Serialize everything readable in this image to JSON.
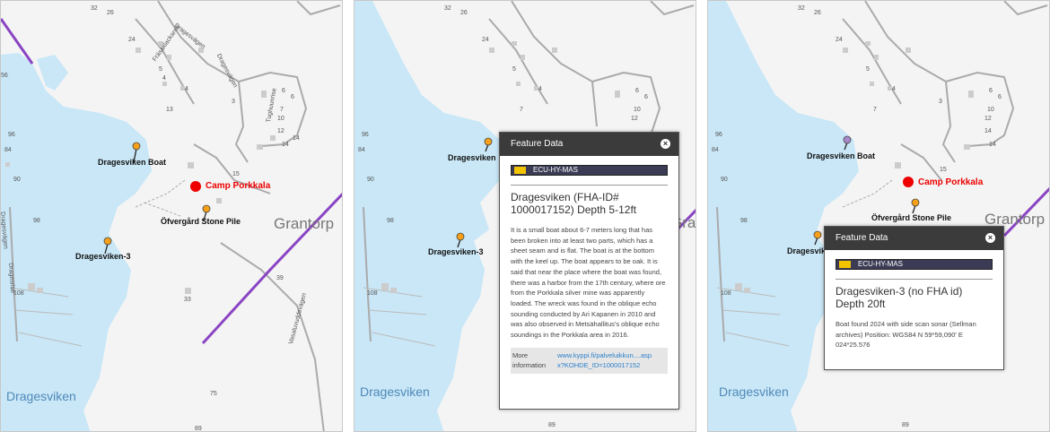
{
  "colors": {
    "water": "#c9e7f7",
    "land": "#f4f4f4",
    "road": "#aaaaaa",
    "border": "#8a44c4",
    "pin": "#f7a11a",
    "camp": "#ee0000"
  },
  "panels": [
    {
      "numbers": [
        "32",
        "26",
        "24",
        "4",
        "5",
        "13",
        "4",
        "6",
        "6",
        "3",
        "7",
        "10",
        "12",
        "14",
        "14",
        "15",
        "96",
        "84",
        "90",
        "98",
        "108",
        "39",
        "33",
        "75",
        "89",
        "56"
      ],
      "roads": [
        "Dragesvägen",
        "Fräsaklackarne",
        "Dragesvägen",
        "Tughuunrise",
        "Dragesvägen",
        "Dragesrise",
        "Vasaluvuddsvägen"
      ],
      "pins": [
        {
          "name": "Dragesviken  Boat"
        },
        {
          "name": "Öfvergård Stone Pile"
        },
        {
          "name": "Dragesviken-3"
        }
      ],
      "camp": "Camp Porkkala",
      "place": "Grantorp",
      "water": "Dragesviken"
    },
    {
      "pins": [
        {
          "name": "Dragesviken"
        },
        {
          "name": "Dragesviken-3"
        }
      ],
      "place": "Grantorp",
      "water": "Dragesviken",
      "numbers": [
        "32",
        "26",
        "24",
        "4",
        "5",
        "6",
        "6",
        "7",
        "10",
        "12",
        "96",
        "84",
        "90",
        "98",
        "108",
        "89"
      ],
      "popup": {
        "header": "Feature Data",
        "close": "×",
        "tag": "ECU-HY-MAS",
        "title": "Dragesviken (FHA-ID# 1000017152) Depth 5-12ft",
        "body": "It is a small boat about 6-7 meters long that has been broken into at least two parts, which has a sheet seam and is flat. The boat is at the bottom with the keel up. The boat appears to be oak. It is said that near the place where the boat was found, there was a harbor from the 17th century, where ore from the Porkkala silver mine was apparently loaded. The wreck was found in the oblique echo sounding conducted by Ari Kapanen in 2010 and was also observed in Metsähallitus's oblique echo soundings in the Porkkala area in 2016.",
        "more_label": "More information",
        "more_link": "www.kyppi.fi/palveluikkun....aspx?KOHDE_ID=1000017152"
      }
    },
    {
      "pins": [
        {
          "name": "Dragesviken  Boat"
        },
        {
          "name": "Öfvergård Stone Pile"
        },
        {
          "name": "Dragesviken-3"
        }
      ],
      "camp": "Camp Porkkala",
      "place": "Grantorp",
      "water": "Dragesviken",
      "numbers": [
        "32",
        "26",
        "24",
        "4",
        "5",
        "6",
        "6",
        "3",
        "7",
        "10",
        "12",
        "14",
        "14",
        "15",
        "96",
        "84",
        "90",
        "98",
        "108",
        "89"
      ],
      "popup": {
        "header": "Feature Data",
        "close": "×",
        "tag": "ECU-HY-MAS",
        "title": "Dragesviken-3 (no FHA id) Depth 20ft",
        "body": "Boat found 2024 with side scan sonar (Sellman archives) Position: WGS84 N 59*59,090' E 024*25.576"
      }
    }
  ]
}
